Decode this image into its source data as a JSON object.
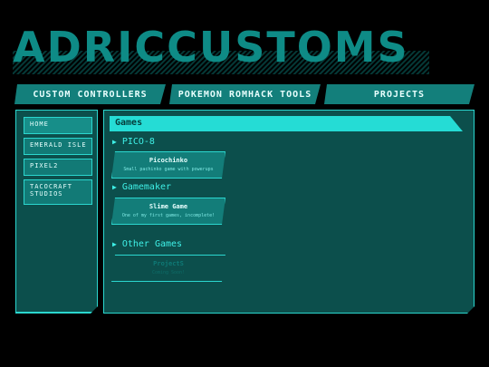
{
  "site": {
    "logo_text": "ADRICCUSTOMS"
  },
  "topnav": [
    {
      "label": "Custom Controllers"
    },
    {
      "label": "Pokemon Romhack Tools"
    },
    {
      "label": "Projects"
    }
  ],
  "sidebar": {
    "items": [
      {
        "label": "Home"
      },
      {
        "label": "Emerald Isle"
      },
      {
        "label": "Pixel2"
      },
      {
        "label": "Tacocraft Studios"
      }
    ]
  },
  "main": {
    "heading": "Games",
    "sections": [
      {
        "title": "PICO-8",
        "cards": [
          {
            "title": "Picochinko",
            "desc": "Small pachinko game with powerups"
          }
        ]
      },
      {
        "title": "Gamemaker",
        "cards": [
          {
            "title": "Slime Game",
            "desc": "One of my first games, incomplete!"
          }
        ]
      },
      {
        "title": "Other Games",
        "cards": [
          {
            "title": "ProjectS",
            "desc": "Coming Soon!"
          }
        ]
      }
    ]
  },
  "colors": {
    "accent": "#25dcd5",
    "panel": "#0c4f4c",
    "button": "#137f7b",
    "background": "#000000"
  }
}
